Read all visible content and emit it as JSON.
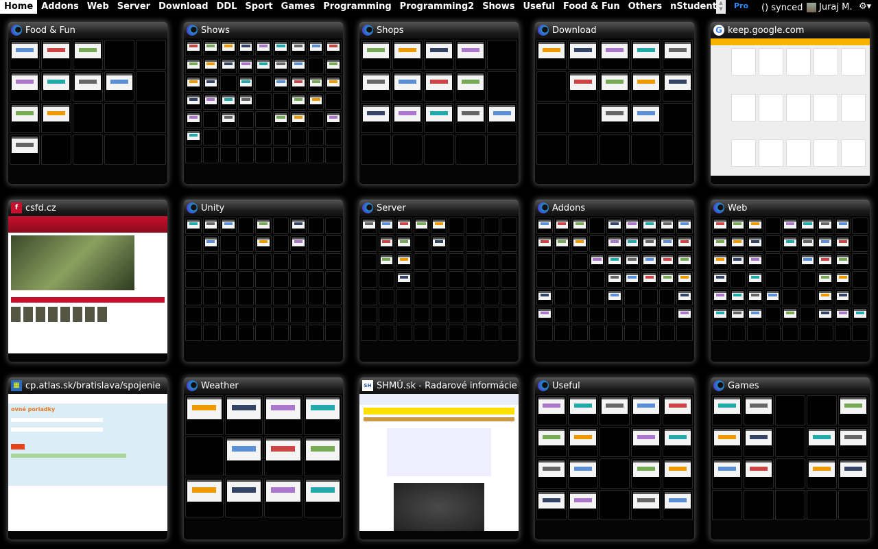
{
  "nav": {
    "items": [
      "Home",
      "Addons",
      "Web",
      "Server",
      "Download",
      "DDL",
      "Sport",
      "Games",
      "Programming",
      "Programming2",
      "Shows",
      "Useful",
      "Food & Fun",
      "Others",
      "nStudent"
    ],
    "active": "Home"
  },
  "topbar": {
    "pro": "Pro",
    "sync_icon": "sync-icon",
    "synced": "synced",
    "user": "Juraj M.",
    "settings_icon": "gear-icon"
  },
  "tiles": [
    {
      "title": "Food & Fun",
      "kind": "group",
      "cols": 5,
      "rows": 4,
      "filled": [
        0,
        1,
        2,
        5,
        6,
        7,
        8,
        10,
        11,
        15
      ]
    },
    {
      "title": "Shows",
      "kind": "group",
      "cols": 9,
      "rows": 7,
      "filled": [
        0,
        1,
        2,
        3,
        4,
        5,
        6,
        7,
        8,
        9,
        10,
        11,
        12,
        13,
        14,
        15,
        17,
        18,
        19,
        21,
        23,
        24,
        25,
        26,
        27,
        28,
        29,
        30,
        33,
        34,
        36,
        38,
        41,
        42,
        44,
        45
      ]
    },
    {
      "title": "Shops",
      "kind": "group",
      "cols": 5,
      "rows": 4,
      "filled": [
        0,
        1,
        2,
        3,
        5,
        6,
        7,
        8,
        10,
        11,
        12,
        13,
        14
      ]
    },
    {
      "title": "Download",
      "kind": "group",
      "cols": 5,
      "rows": 4,
      "filled": [
        0,
        1,
        2,
        3,
        4,
        6,
        7,
        8,
        9,
        12,
        13
      ]
    },
    {
      "title": "keep.google.com",
      "kind": "shot",
      "icon": "google",
      "theme": "keep"
    },
    {
      "title": "csfd.cz",
      "kind": "shot",
      "icon": "csfd",
      "theme": "csfd"
    },
    {
      "title": "Unity",
      "kind": "group",
      "cols": 9,
      "rows": 7,
      "filled": [
        0,
        1,
        2,
        4,
        6,
        10,
        13,
        15
      ]
    },
    {
      "title": "Server",
      "kind": "group",
      "cols": 9,
      "rows": 7,
      "filled": [
        0,
        1,
        2,
        3,
        4,
        10,
        11,
        13,
        19,
        20,
        29
      ]
    },
    {
      "title": "Addons",
      "kind": "group",
      "cols": 9,
      "rows": 7,
      "filled": [
        0,
        1,
        2,
        4,
        5,
        6,
        7,
        8,
        9,
        10,
        11,
        13,
        14,
        15,
        16,
        17,
        21,
        22,
        23,
        24,
        25,
        26,
        31,
        32,
        33,
        34,
        35,
        36,
        40,
        44,
        45,
        53
      ]
    },
    {
      "title": "Web",
      "kind": "group",
      "cols": 9,
      "rows": 7,
      "filled": [
        0,
        1,
        2,
        4,
        5,
        6,
        7,
        9,
        10,
        11,
        13,
        14,
        15,
        16,
        18,
        19,
        20,
        23,
        24,
        25,
        27,
        29,
        33,
        34,
        36,
        37,
        38,
        39,
        42,
        43,
        45,
        46,
        47,
        49,
        51,
        52,
        53
      ]
    },
    {
      "title": "cp.atlas.sk/bratislava/spojenie",
      "kind": "shot",
      "icon": "atlas",
      "theme": "atlas"
    },
    {
      "title": "Weather",
      "kind": "group",
      "cols": 4,
      "rows": 3,
      "filled": [
        0,
        1,
        2,
        3,
        5,
        6,
        7,
        8,
        9,
        10,
        11
      ]
    },
    {
      "title": "SHMÚ.sk - Radarové informácie",
      "kind": "shot",
      "icon": "shmu",
      "theme": "shmu"
    },
    {
      "title": "Useful",
      "kind": "group",
      "cols": 5,
      "rows": 4,
      "filled": [
        0,
        1,
        2,
        3,
        4,
        5,
        6,
        8,
        9,
        10,
        11,
        13,
        14,
        15,
        16,
        18,
        19
      ]
    },
    {
      "title": "Games",
      "kind": "group",
      "cols": 5,
      "rows": 4,
      "filled": [
        0,
        1,
        4,
        5,
        6,
        8,
        9,
        10,
        11,
        13,
        14
      ]
    }
  ],
  "colors": {
    "accent": "#2a8cff",
    "keep": "#f6b400",
    "csfd": "#c8102e",
    "atlas": "#dbeef8",
    "shmu": "#1f4fa8"
  }
}
